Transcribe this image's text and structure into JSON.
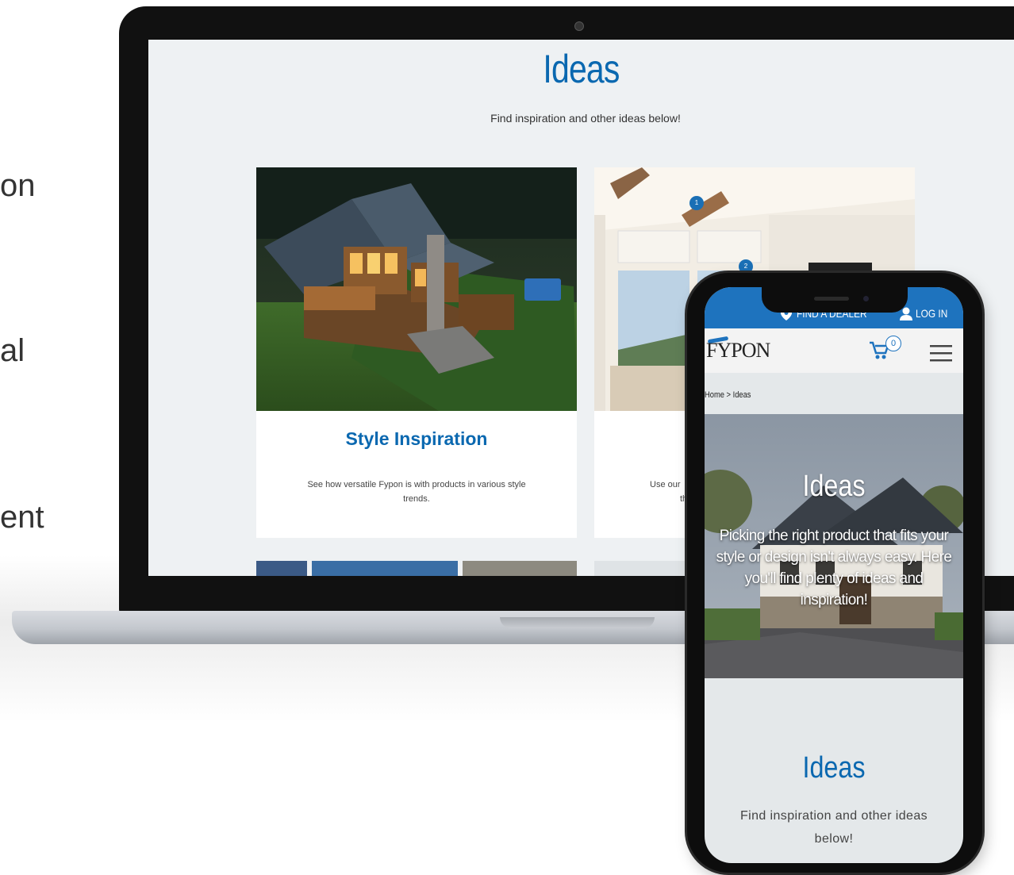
{
  "side_fragments": [
    "on",
    "al",
    "ent"
  ],
  "desktop": {
    "title": "Ideas",
    "subtitle": "Find inspiration and other ideas below!",
    "cards": [
      {
        "title": "Style Inspiration",
        "description": "See how versatile Fypon is with products in various style trends."
      },
      {
        "description_partial_1": "Use our",
        "description_partial_2": "th"
      }
    ],
    "hotspots": [
      "1",
      "2"
    ]
  },
  "mobile": {
    "find_dealer": "FIND A DEALER",
    "log_in": "LOG IN",
    "logo": "FYPON",
    "cart_count": "0",
    "breadcrumb": "Home > Ideas",
    "hero_title": "Ideas",
    "hero_text": "Picking the right product that fits your style or design isn't always easy. Here you'll find plenty of ideas and inspiration!",
    "section_title": "Ideas",
    "section_subtitle": "Find inspiration and other ideas below!"
  },
  "colors": {
    "brand_blue": "#0a68b0",
    "topbar_blue": "#1e73be"
  }
}
